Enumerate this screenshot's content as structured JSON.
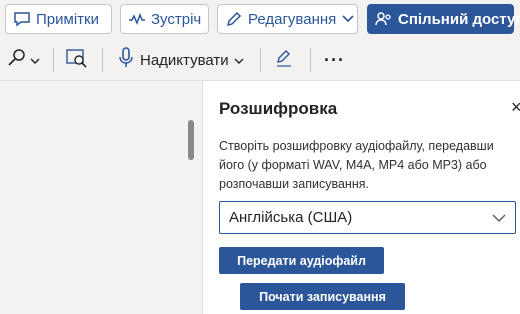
{
  "top_buttons": {
    "comments_label": "Примітки",
    "meet_label": "Зустріч",
    "editing_label": "Редагування",
    "share_label": "Спільний доступ"
  },
  "toolbar": {
    "dictate_label": "Надиктувати",
    "more_label": "···"
  },
  "pane": {
    "title": "Розшифровка",
    "close_label": "×",
    "description": "Створіть розшифровку аудіофайлу, передавши його (у форматі WAV, M4A, MP4 або MP3) або розпочавши записування.",
    "language_value": "Англійська (США)",
    "upload_label": "Передати аудіофайл",
    "record_label": "Почати записування"
  },
  "colors": {
    "accent": "#2b579a",
    "ribbon_bg": "#f3f2f1",
    "pane_bg": "#ffffff"
  },
  "icons": [
    "comment-icon",
    "meet-icon",
    "pencil-icon",
    "chevron-down-icon",
    "share-people-icon",
    "search-icon",
    "immersive-reader-icon",
    "microphone-icon",
    "editor-pen-icon",
    "close-icon"
  ]
}
